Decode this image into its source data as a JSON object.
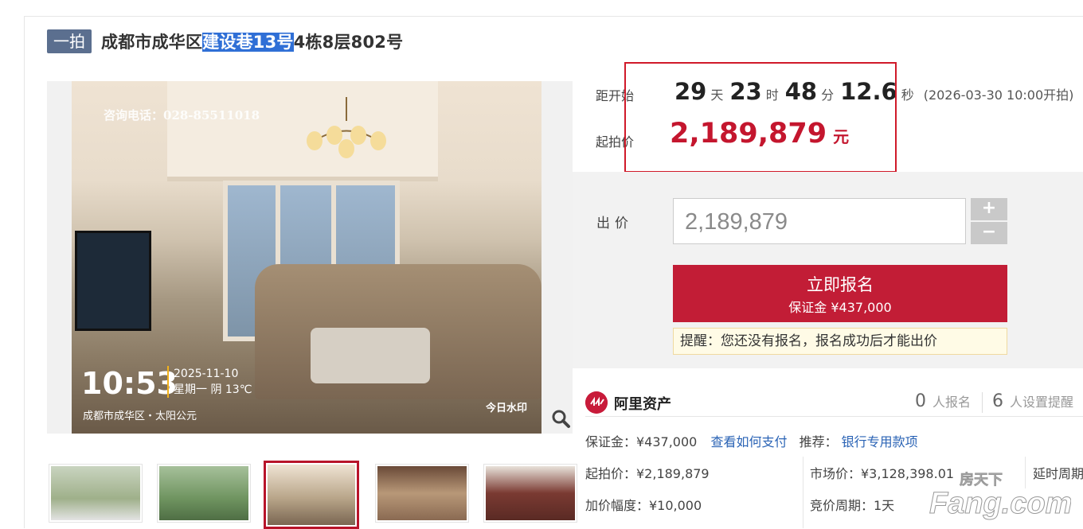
{
  "header": {
    "badge": "一拍",
    "title_pre": "成都市成华区",
    "title_highlight": "建设巷13号",
    "title_post": "4栋8层802号"
  },
  "photo": {
    "watermark_phone": "咨询电话：028-85511018",
    "watermark_time": "10:53",
    "watermark_date": "2025-11-10",
    "watermark_weather": "星期一 阴 13℃",
    "watermark_location": "成都市成华区・太阳公元",
    "watermark_brand": "今日水印"
  },
  "thumbnails": [
    {
      "active": false,
      "color": "#9fb08a"
    },
    {
      "active": false,
      "color": "#6f9460"
    },
    {
      "active": true,
      "color": "#b9a68a"
    },
    {
      "active": false,
      "color": "#8a6a52"
    },
    {
      "active": false,
      "color": "#7a3a32"
    }
  ],
  "countdown": {
    "label": "距开始",
    "days": "29",
    "days_unit": "天",
    "hours": "23",
    "hours_unit": "时",
    "minutes": "48",
    "minutes_unit": "分",
    "seconds": "12.6",
    "seconds_unit": "秒",
    "start_time": "(2026-03-30 10:00开拍)"
  },
  "start_price": {
    "label": "起拍价",
    "value": "2,189,879",
    "unit": "元"
  },
  "bid": {
    "label": "出价",
    "input_value": "2,189,879",
    "plus": "+",
    "minus": "−",
    "signup_label": "立即报名",
    "deposit_line": "保证金 ¥437,000",
    "tip": "提醒：您还没有报名，报名成功后才能出价"
  },
  "platform": {
    "name": "阿里资产",
    "signups_count": "0",
    "signups_label": "人报名",
    "reminders_count": "6",
    "reminders_label": "人设置提醒"
  },
  "details": {
    "deposit": "保证金：¥437,000",
    "how_to_pay": "查看如何支付",
    "recommend_label": "推荐：",
    "recommend_link": "银行专用款项",
    "start_price": "起拍价：¥2,189,879",
    "market_price": "市场价：¥3,128,398.01",
    "delay": "延时周期",
    "increment": "加价幅度：¥10,000",
    "bid_cycle": "竞价周期：1天"
  },
  "watermark_site": {
    "cn": "房天下",
    "en": "Fang.com"
  },
  "colors": {
    "accent_red": "#c4162e",
    "badge_blue": "#5b6f8f",
    "link_blue": "#2a63b5"
  }
}
